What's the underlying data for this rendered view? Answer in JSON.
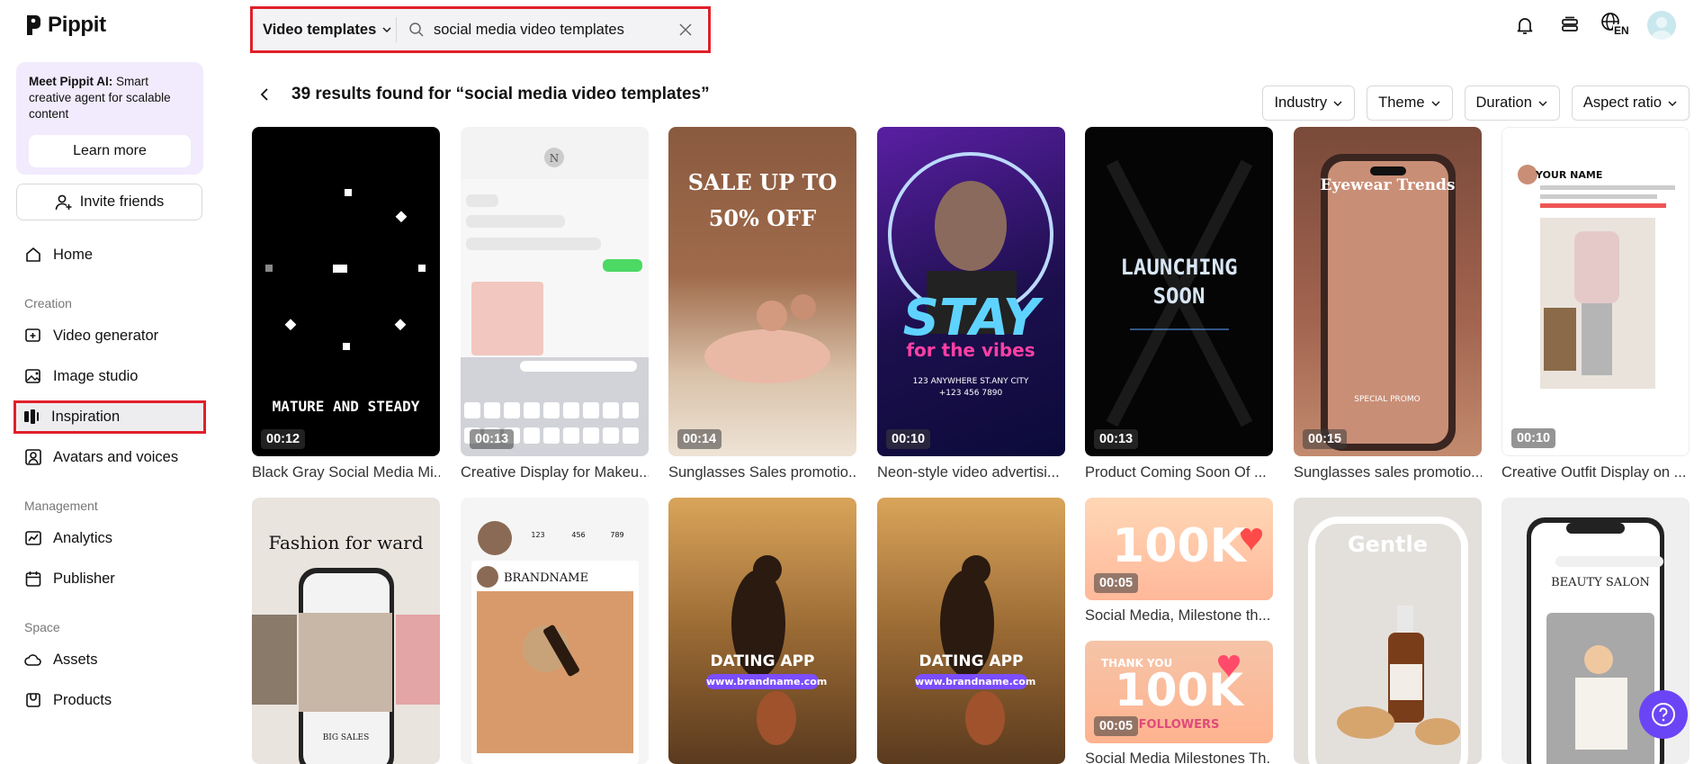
{
  "app": {
    "name": "Pippit"
  },
  "sidebar": {
    "promo": {
      "title": "Meet Pippit AI:",
      "text": " Smart creative agent for scalable content",
      "button": "Learn more"
    },
    "invite": "Invite friends",
    "home": "Home",
    "sections": {
      "creation": "Creation",
      "management": "Management",
      "space": "Space"
    },
    "items": {
      "video_generator": "Video generator",
      "image_studio": "Image studio",
      "inspiration": "Inspiration",
      "avatars": "Avatars and voices",
      "analytics": "Analytics",
      "publisher": "Publisher",
      "assets": "Assets",
      "products": "Products"
    }
  },
  "search": {
    "type_label": "Video templates",
    "query": "social media video templates"
  },
  "header": {
    "lang": "EN"
  },
  "results": {
    "title": "39 results found for “social media video templates”"
  },
  "filters": [
    "Industry",
    "Theme",
    "Duration",
    "Aspect ratio"
  ],
  "cards_row1": [
    {
      "title": "Black Gray Social Media Mi...",
      "duration": "00:12",
      "overlay": "MATURE AND STEADY"
    },
    {
      "title": "Creative Display for Makeu...",
      "duration": "00:13",
      "overlay": ""
    },
    {
      "title": "Sunglasses Sales promotio...",
      "duration": "00:14",
      "overlay": "SALE UP TO 50% OFF"
    },
    {
      "title": "Neon-style video advertisi...",
      "duration": "00:10",
      "overlay": "STAY"
    },
    {
      "title": "Product Coming Soon Of ...",
      "duration": "00:13",
      "overlay": "LAUNCHING SOON"
    },
    {
      "title": "Sunglasses sales promotio...",
      "duration": "00:15",
      "overlay": "Eyewear Trends"
    },
    {
      "title": "Creative Outfit Display on ...",
      "duration": "00:10",
      "overlay": "YOUR NAME"
    }
  ],
  "cards_row2": [
    {
      "title": "",
      "duration": "",
      "overlay": "Fashion for ward",
      "sub": "BIG SALES"
    },
    {
      "title": "",
      "duration": "",
      "overlay": "BRANDNAME"
    },
    {
      "title": "",
      "duration": "",
      "overlay": "DATING APP",
      "sub": "www.brandname.com"
    },
    {
      "title": "",
      "duration": "",
      "overlay": "DATING APP",
      "sub": "www.brandname.com"
    },
    {
      "title": "Social Media, Milestone th...",
      "duration": "00:05",
      "overlay": "100K"
    },
    {
      "title": "",
      "duration": "",
      "overlay": "Gentle"
    },
    {
      "title": "",
      "duration": "",
      "overlay": "BEAUTY SALON"
    }
  ],
  "card_extra": {
    "title": "Social Media Milestones Th...",
    "duration": "00:05",
    "overlay": "100K",
    "sub1": "THANK YOU",
    "sub2": "FOLLOWERS"
  },
  "colors": {
    "highlight": "#e0202a",
    "promo_bg": "#f1ebfd",
    "help": "#6b45f5"
  }
}
